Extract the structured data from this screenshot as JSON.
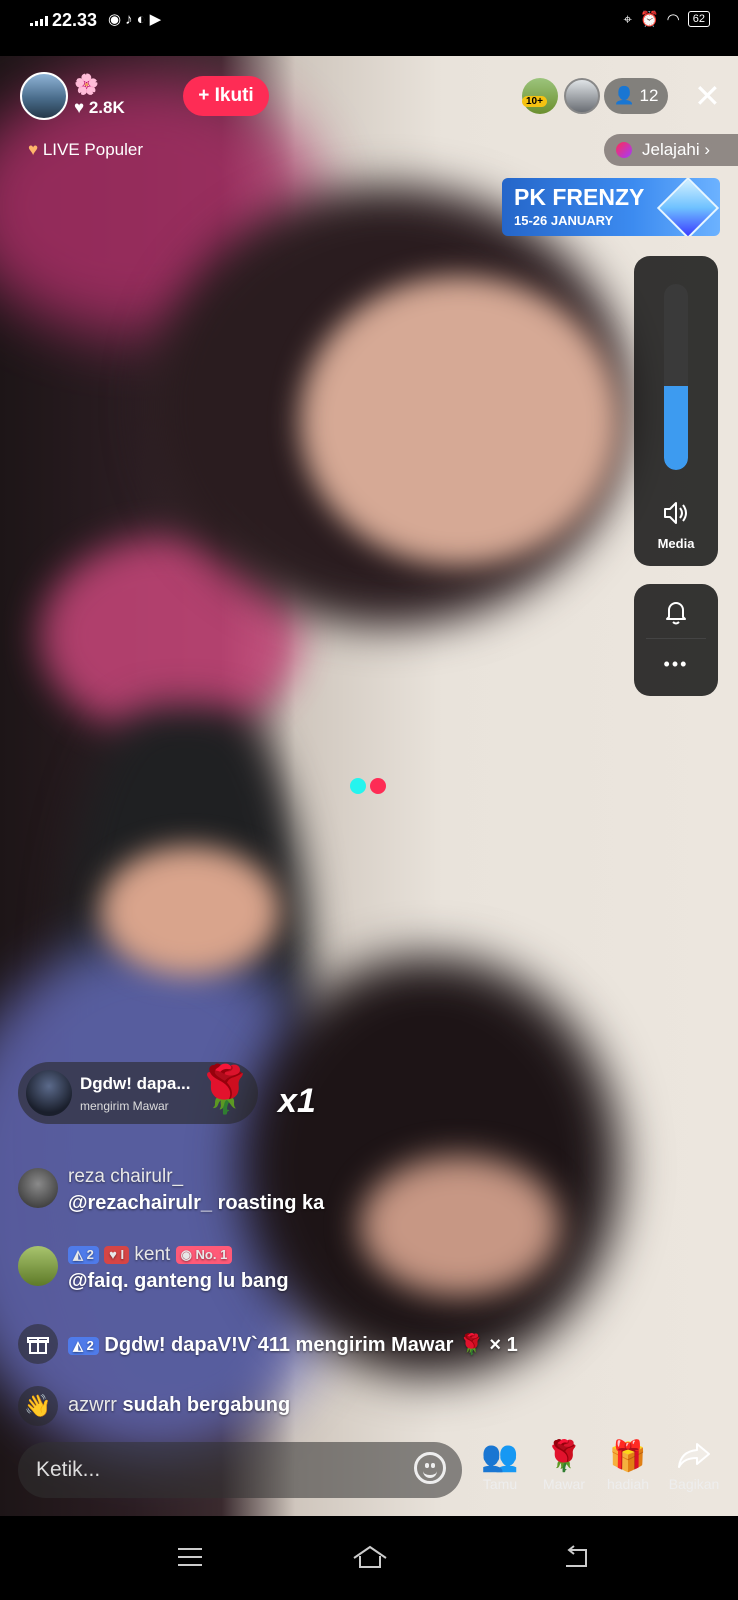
{
  "status_bar": {
    "time": "22.33",
    "battery": "62"
  },
  "stream": {
    "host_likes": "2.8K",
    "follow_label": "+ Ikuti",
    "live_popular": "LIVE Populer",
    "viewer_count": "12",
    "top_badge": "10+",
    "explore_label": "Jelajahi",
    "event_title": "PK FRENZY",
    "event_dates": "15-26 JANUARY",
    "media_label": "Media",
    "volume_level": 0.45
  },
  "gift_banner": {
    "sender": "Dgdw! dapa...",
    "action": "mengirim Mawar",
    "count": "x1"
  },
  "chat": [
    {
      "name": "reza chairulr_",
      "message": "@rezachairulr_ roasting ka"
    },
    {
      "level": "2",
      "fan_level": "I",
      "name": "kent",
      "rank": "No. 1",
      "message": "@faiq. ganteng lu bang"
    }
  ],
  "events": {
    "gift_level": "2",
    "gift_text": "Dgdw! dapaV!V`411 mengirim Mawar",
    "gift_count": "× 1",
    "join_name": "azwrr",
    "join_text": "sudah bergabung"
  },
  "bottom_bar": {
    "input_placeholder": "Ketik...",
    "actions": [
      {
        "label": "Tamu"
      },
      {
        "label": "Mawar"
      },
      {
        "label": "hadiah"
      },
      {
        "label": "Bagikan"
      }
    ]
  },
  "colors": {
    "accent": "#fe2c55",
    "volume": "#3d9bf0",
    "level_badge": "#4f7bea"
  }
}
